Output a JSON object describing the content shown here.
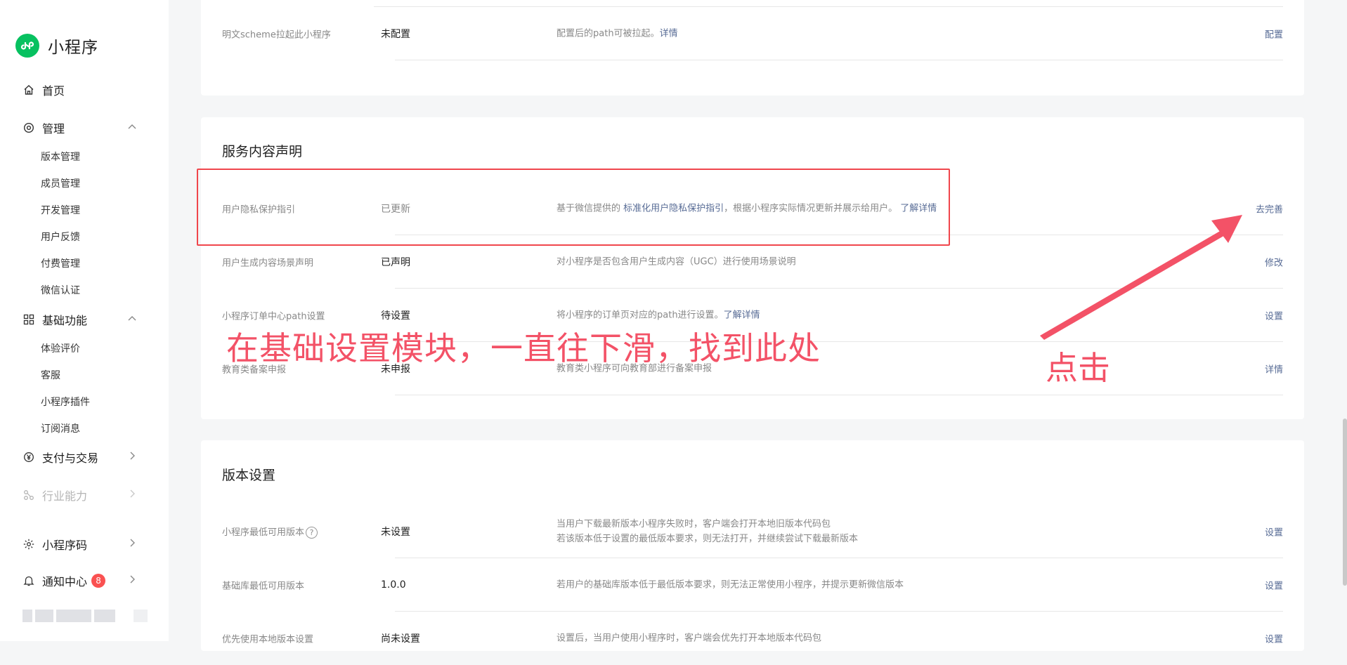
{
  "sidebar": {
    "app_name": "小程序",
    "home": "首页",
    "manage": {
      "label": "管理",
      "items": [
        "版本管理",
        "成员管理",
        "开发管理",
        "用户反馈",
        "付费管理",
        "微信认证"
      ]
    },
    "basic": {
      "label": "基础功能",
      "items": [
        "体验评价",
        "客服",
        "小程序插件",
        "订阅消息"
      ]
    },
    "payment": "支付与交易",
    "industry": "行业能力",
    "qrcode": "小程序码",
    "notifications": {
      "label": "通知中心",
      "count": "8"
    }
  },
  "top_card": {
    "row": {
      "label": "明文scheme拉起此小程序",
      "status": "未配置",
      "desc": "配置后的path可被拉起。",
      "desc_link": "详情",
      "action": "配置"
    }
  },
  "service_card": {
    "title": "服务内容声明",
    "rows": [
      {
        "label": "用户隐私保护指引",
        "status": "已更新",
        "desc_pre": "基于微信提供的 ",
        "desc_link1": "标准化用户隐私保护指引",
        "desc_mid": "，根据小程序实际情况更新并展示给用户。 ",
        "desc_link2": "了解详情",
        "action": "去完善"
      },
      {
        "label": "用户生成内容场景声明",
        "status": "已声明",
        "desc": "对小程序是否包含用户生成内容（UGC）进行使用场景说明",
        "action": "修改"
      },
      {
        "label": "小程序订单中心path设置",
        "status": "待设置",
        "desc": "将小程序的订单页对应的path进行设置。",
        "desc_link": "了解详情",
        "action": "设置"
      },
      {
        "label": "教育类备案申报",
        "status": "未申报",
        "desc": "教育类小程序可向教育部进行备案申报",
        "action": "详情"
      }
    ]
  },
  "version_card": {
    "title": "版本设置",
    "rows": [
      {
        "label": "小程序最低可用版本",
        "help": "?",
        "status": "未设置",
        "desc_line1": "当用户下载最新版本小程序失败时，客户端会打开本地旧版本代码包",
        "desc_line2": "若该版本低于设置的最低版本要求，则无法打开，并继续尝试下载最新版本",
        "action": "设置"
      },
      {
        "label": "基础库最低可用版本",
        "status": "1.0.0",
        "desc": "若用户的基础库版本低于最低版本要求，则无法正常使用小程序，并提示更新微信版本",
        "action": "设置"
      },
      {
        "label": "优先使用本地版本设置",
        "status": "尚未设置",
        "desc": "设置后，当用户使用小程序时，客户端会优先打开本地版本代码包",
        "action": "设置"
      }
    ]
  },
  "annotations": {
    "main_text": "在基础设置模块，一直往下滑，找到此处",
    "click_text": "点击",
    "color": "#f35267"
  },
  "colors": {
    "brand": "#07c160",
    "link": "#576b95",
    "badge": "#fa5151"
  }
}
